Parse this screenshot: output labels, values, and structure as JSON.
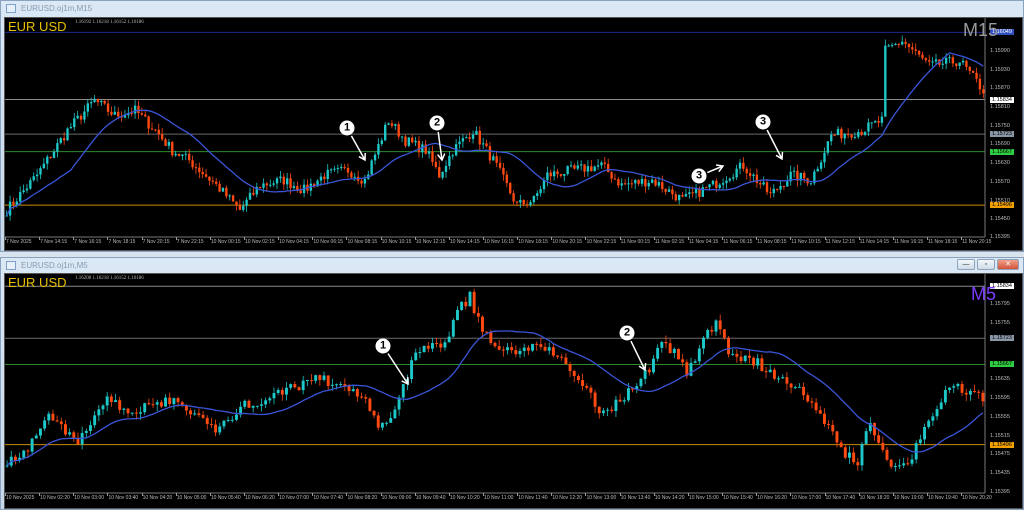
{
  "windows": [
    {
      "title": "EURUSD.oj1m,M15",
      "symbol": "EUR USD",
      "ohlc": "1.16192 1.16218 1.16152 1.16186",
      "timeframe": "M15",
      "timeframe_color": "#9a9a9a",
      "price_ticks": [
        "1.15990",
        "1.15930",
        "1.15870",
        "1.15810",
        "1.15750",
        "1.15690",
        "1.15630",
        "1.15570",
        "1.15510",
        "1.15450",
        "1.15395"
      ],
      "price_range": [
        1.15397,
        1.16095
      ],
      "levels": [
        {
          "price": "1.16049",
          "color": "#1c2a8c",
          "box": "#3050c0"
        },
        {
          "price": "1.15834",
          "color": "#8a8a8a",
          "box": "#ffffff"
        },
        {
          "price": "1.15723",
          "color": "#6a6a6a",
          "box": "#8a96a6"
        },
        {
          "price": "1.15667",
          "color": "#2e8b2e",
          "box": "#2ecc40"
        },
        {
          "price": "1.15496",
          "color": "#c98a00",
          "box": "#f0a000"
        }
      ],
      "time_labels": [
        "7 Nov 2025",
        "7 Nov 14:15",
        "7 Nov 16:15",
        "7 Nov 18:15",
        "7 Nov 20:15",
        "7 Nov 22:15",
        "10 Nov 00:15",
        "10 Nov 02:15",
        "10 Nov 04:15",
        "10 Nov 06:15",
        "10 Nov 08:15",
        "10 Nov 10:15",
        "10 Nov 12:15",
        "10 Nov 14:15",
        "10 Nov 16:15",
        "10 Nov 18:15",
        "10 Nov 20:15",
        "10 Nov 22:15",
        "11 Nov 00:15",
        "11 Nov 02:15",
        "11 Nov 04:15",
        "11 Nov 06:15",
        "11 Nov 08:15",
        "11 Nov 10:15",
        "11 Nov 12:15",
        "11 Nov 14:15",
        "11 Nov 16:15",
        "11 Nov 18:15",
        "11 Nov 20:15"
      ],
      "bars": 290,
      "close_path": [
        [
          0,
          1.1548
        ],
        [
          9,
          1.15592
        ],
        [
          18,
          1.15735
        ],
        [
          26,
          1.15831
        ],
        [
          32,
          1.15783
        ],
        [
          38,
          1.15799
        ],
        [
          44,
          1.15735
        ],
        [
          49,
          1.15671
        ],
        [
          54,
          1.15639
        ],
        [
          62,
          1.1556
        ],
        [
          69,
          1.1548
        ],
        [
          75,
          1.1556
        ],
        [
          82,
          1.15576
        ],
        [
          88,
          1.15544
        ],
        [
          94,
          1.15592
        ],
        [
          101,
          1.15608
        ],
        [
          106,
          1.15576
        ],
        [
          113,
          1.15767
        ],
        [
          118,
          1.15703
        ],
        [
          124,
          1.15671
        ],
        [
          128,
          1.15592
        ],
        [
          132,
          1.15671
        ],
        [
          138,
          1.15735
        ],
        [
          144,
          1.15639
        ],
        [
          151,
          1.15496
        ],
        [
          156,
          1.15512
        ],
        [
          160,
          1.15592
        ],
        [
          168,
          1.15608
        ],
        [
          176,
          1.15623
        ],
        [
          182,
          1.1556
        ],
        [
          191,
          1.15576
        ],
        [
          200,
          1.15512
        ],
        [
          209,
          1.1556
        ],
        [
          218,
          1.15623
        ],
        [
          226,
          1.15528
        ],
        [
          232,
          1.15592
        ],
        [
          238,
          1.15576
        ],
        [
          244,
          1.15719
        ],
        [
          253,
          1.15735
        ],
        [
          259,
          1.15767
        ],
        [
          260,
          1.1599
        ],
        [
          265,
          1.16022
        ],
        [
          273,
          1.15942
        ],
        [
          282,
          1.15958
        ],
        [
          289,
          1.15863
        ]
      ],
      "ma_period": 20,
      "annotations": [
        "1",
        "2",
        "3",
        "3"
      ]
    },
    {
      "title": "EURUSD.oj1m,M5",
      "symbol": "EUR USD",
      "ohlc": "1.16208 1.16218 1.16152 1.16186",
      "timeframe": "M5",
      "timeframe_color": "#7b3cff",
      "price_ticks": [
        "1.15795",
        "1.15755",
        "1.15635",
        "1.15595",
        "1.15555",
        "1.15515",
        "1.15475",
        "1.15435",
        "1.15395"
      ],
      "price_range": [
        1.15395,
        1.1586
      ],
      "levels": [
        {
          "price": "1.15834",
          "color": "#8a8a8a",
          "box": "#ffffff"
        },
        {
          "price": "1.15723",
          "color": "#6a6a6a",
          "box": "#8a96a6"
        },
        {
          "price": "1.15667",
          "color": "#2e8b2e",
          "box": "#2ecc40"
        },
        {
          "price": "1.15496",
          "color": "#c98a00",
          "box": "#f0a000"
        }
      ],
      "time_labels": [
        "10 Nov 2025",
        "10 Nov 02:20",
        "10 Nov 03:00",
        "10 Nov 03:40",
        "10 Nov 04:20",
        "10 Nov 05:00",
        "10 Nov 05:40",
        "10 Nov 06:20",
        "10 Nov 07:00",
        "10 Nov 07:40",
        "10 Nov 08:20",
        "10 Nov 09:00",
        "10 Nov 09:40",
        "10 Nov 10:20",
        "10 Nov 11:00",
        "10 Nov 11:40",
        "10 Nov 12:20",
        "10 Nov 13:00",
        "10 Nov 13:40",
        "10 Nov 14:20",
        "10 Nov 15:00",
        "10 Nov 15:40",
        "10 Nov 16:20",
        "10 Nov 17:00",
        "10 Nov 17:40",
        "10 Nov 18:20",
        "10 Nov 19:00",
        "10 Nov 19:40",
        "10 Nov 20:20"
      ],
      "bars": 235,
      "close_path": [
        [
          0,
          1.15463
        ],
        [
          5,
          1.15484
        ],
        [
          10,
          1.15558
        ],
        [
          17,
          1.15505
        ],
        [
          24,
          1.15589
        ],
        [
          31,
          1.15568
        ],
        [
          38,
          1.15589
        ],
        [
          43,
          1.15579
        ],
        [
          50,
          1.15526
        ],
        [
          57,
          1.15579
        ],
        [
          67,
          1.1561
        ],
        [
          74,
          1.15642
        ],
        [
          81,
          1.15621
        ],
        [
          86,
          1.15589
        ],
        [
          89,
          1.15526
        ],
        [
          94,
          1.15589
        ],
        [
          98,
          1.15695
        ],
        [
          105,
          1.15716
        ],
        [
          108,
          1.15779
        ],
        [
          111,
          1.15811
        ],
        [
          114,
          1.15737
        ],
        [
          119,
          1.15695
        ],
        [
          126,
          1.15705
        ],
        [
          132,
          1.15695
        ],
        [
          136,
          1.15631
        ],
        [
          140,
          1.156
        ],
        [
          143,
          1.15558
        ],
        [
          149,
          1.1561
        ],
        [
          154,
          1.15653
        ],
        [
          157,
          1.15726
        ],
        [
          163,
          1.15653
        ],
        [
          167,
          1.15716
        ],
        [
          170,
          1.15758
        ],
        [
          173,
          1.15695
        ],
        [
          179,
          1.15674
        ],
        [
          185,
          1.15642
        ],
        [
          190,
          1.15621
        ],
        [
          195,
          1.15568
        ],
        [
          200,
          1.15484
        ],
        [
          204,
          1.15463
        ],
        [
          207,
          1.15547
        ],
        [
          212,
          1.15442
        ],
        [
          217,
          1.15473
        ],
        [
          221,
          1.15547
        ],
        [
          226,
          1.15621
        ],
        [
          232,
          1.156
        ],
        [
          234,
          1.156
        ]
      ],
      "ma_period": 20,
      "annotations": [
        "1",
        "2"
      ]
    }
  ],
  "colors": {
    "bull": "#1ec8c8",
    "bear": "#ff4a12",
    "ma": "#3a55d8"
  },
  "buttons": {
    "minimize": "—",
    "maximize": "▫",
    "close": "✕"
  }
}
